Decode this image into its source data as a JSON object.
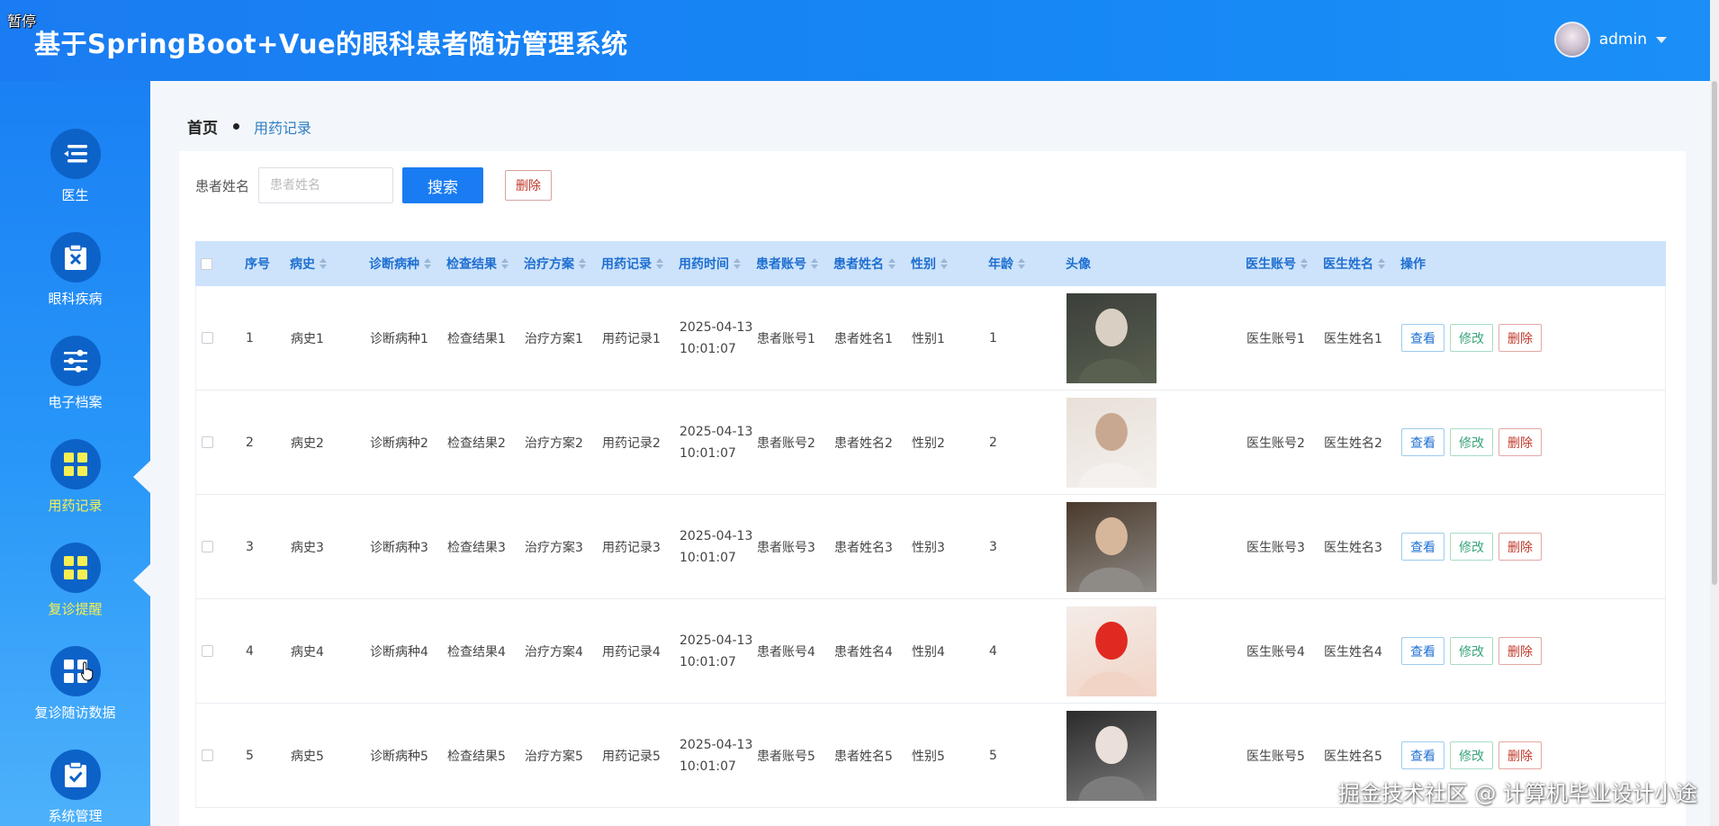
{
  "overlay": {
    "pause_label": "暂停"
  },
  "header": {
    "title": "基于SpringBoot+Vue的眼科患者随访管理系统",
    "username": "admin"
  },
  "sidebar": {
    "items": [
      {
        "label": "医生",
        "icon": "list-icon",
        "active": false
      },
      {
        "label": "眼科疾病",
        "icon": "clipboard-x-icon",
        "active": false
      },
      {
        "label": "电子档案",
        "icon": "sliders-icon",
        "active": false
      },
      {
        "label": "用药记录",
        "icon": "grid-icon",
        "active": true
      },
      {
        "label": "复诊提醒",
        "icon": "grid-icon",
        "active": true
      },
      {
        "label": "复诊随访数据",
        "icon": "grid-icon",
        "active": false
      },
      {
        "label": "系统管理",
        "icon": "clipboard-check-icon",
        "active": false
      }
    ]
  },
  "breadcrumb": {
    "home": "首页",
    "current": "用药记录"
  },
  "search": {
    "label": "患者姓名",
    "placeholder": "患者姓名",
    "value": "",
    "search_button": "搜索",
    "delete_button": "删除"
  },
  "table": {
    "columns": [
      "序号",
      "病史",
      "诊断病种",
      "检查结果",
      "治疗方案",
      "用药记录",
      "用药时间",
      "患者账号",
      "患者姓名",
      "性别",
      "年龄",
      "头像",
      "医生账号",
      "医生姓名",
      "操作"
    ],
    "actions": {
      "view": "查看",
      "edit": "修改",
      "delete": "删除"
    },
    "rows": [
      {
        "no": "1",
        "history": "病史1",
        "diagnosis": "诊断病种1",
        "result": "检查结果1",
        "plan": "治疗方案1",
        "med": "用药记录1",
        "date": "2025-04-13",
        "time": "10:01:07",
        "patient_acct": "患者账号1",
        "patient_name": "患者姓名1",
        "gender": "性别1",
        "age": "1",
        "doctor_acct": "医生账号1",
        "doctor_name": "医生姓名1",
        "avatar_colors": [
          "#3b3f3a",
          "#d9cfc2",
          "#5a6050"
        ]
      },
      {
        "no": "2",
        "history": "病史2",
        "diagnosis": "诊断病种2",
        "result": "检查结果2",
        "plan": "治疗方案2",
        "med": "用药记录2",
        "date": "2025-04-13",
        "time": "10:01:07",
        "patient_acct": "患者账号2",
        "patient_name": "患者姓名2",
        "gender": "性别2",
        "age": "2",
        "doctor_acct": "医生账号2",
        "doctor_name": "医生姓名2",
        "avatar_colors": [
          "#e8e0d8",
          "#c9a892",
          "#f4f1ee"
        ]
      },
      {
        "no": "3",
        "history": "病史3",
        "diagnosis": "诊断病种3",
        "result": "检查结果3",
        "plan": "治疗方案3",
        "med": "用药记录3",
        "date": "2025-04-13",
        "time": "10:01:07",
        "patient_acct": "患者账号3",
        "patient_name": "患者姓名3",
        "gender": "性别3",
        "age": "3",
        "doctor_acct": "医生账号3",
        "doctor_name": "医生姓名3",
        "avatar_colors": [
          "#4a3a2c",
          "#d7b79b",
          "#8e8a86"
        ]
      },
      {
        "no": "4",
        "history": "病史4",
        "diagnosis": "诊断病种4",
        "result": "检查结果4",
        "plan": "治疗方案4",
        "med": "用药记录4",
        "date": "2025-04-13",
        "time": "10:01:07",
        "patient_acct": "患者账号4",
        "patient_name": "患者姓名4",
        "gender": "性别4",
        "age": "4",
        "doctor_acct": "医生账号4",
        "doctor_name": "医生姓名4",
        "avatar_colors": [
          "#f3ece8",
          "#e02a21",
          "#f2d4c6"
        ]
      },
      {
        "no": "5",
        "history": "病史5",
        "diagnosis": "诊断病种5",
        "result": "检查结果5",
        "plan": "治疗方案5",
        "med": "用药记录5",
        "date": "2025-04-13",
        "time": "10:01:07",
        "patient_acct": "患者账号5",
        "patient_name": "患者姓名5",
        "gender": "性别5",
        "age": "5",
        "doctor_acct": "医生账号5",
        "doctor_name": "医生姓名5",
        "avatar_colors": [
          "#2b2b2b",
          "#eadfd9",
          "#7c7c7c"
        ]
      }
    ]
  },
  "watermark": "掘金技术社区 @ 计算机毕业设计小途",
  "colors": {
    "primary": "#1a7cf2",
    "active_label": "#f7ef52",
    "header_text": "#1f6fd1",
    "danger": "#c0392b",
    "success": "#3aa57a"
  }
}
